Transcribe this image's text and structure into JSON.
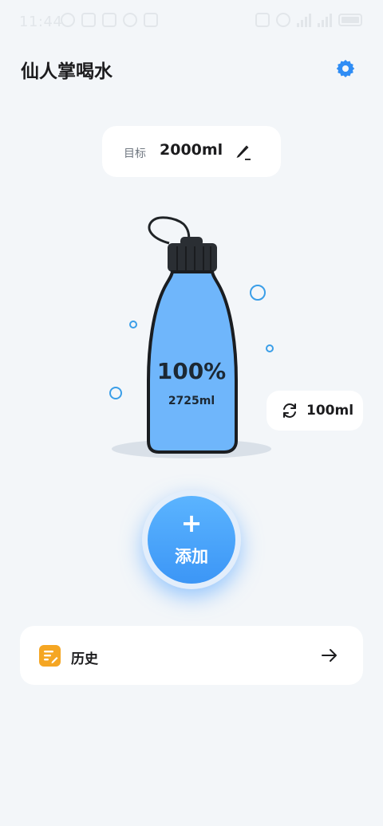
{
  "status_bar": {
    "time": "11:44"
  },
  "header": {
    "title": "仙人掌喝水"
  },
  "goal": {
    "label": "目标",
    "value": "2000ml"
  },
  "progress": {
    "percent_text": "100%",
    "amount_text": "2725ml",
    "fill_fraction": 1.0
  },
  "step": {
    "label": "100ml"
  },
  "add_button": {
    "plus": "+",
    "label": "添加"
  },
  "history": {
    "label": "历史"
  },
  "colors": {
    "accent": "#3c96f6",
    "water": "#6fb6fb",
    "background": "#f3f6f9",
    "history_icon": "#f5a623"
  },
  "icons": {
    "settings": "gear-icon",
    "edit": "pencil-icon",
    "step": "refresh-icon",
    "history": "document-icon",
    "arrow": "arrow-right-icon"
  }
}
